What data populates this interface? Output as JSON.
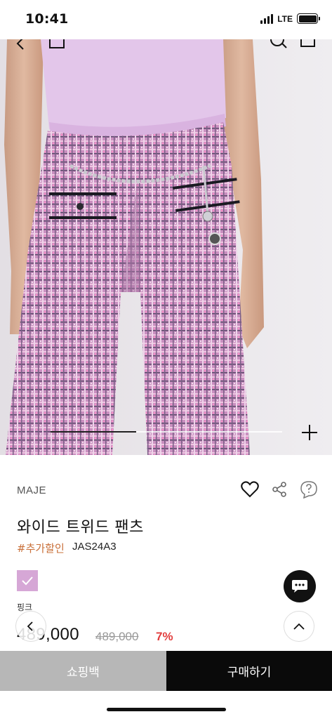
{
  "status_bar": {
    "time": "10:41",
    "network": "LTE"
  },
  "gallery": {
    "current_index_fraction": 0.37
  },
  "product": {
    "brand": "MAJE",
    "title": "와이드 트위드 팬츠",
    "tag": "#추가할인",
    "sku": "JAS24A3",
    "color_label": "핑크",
    "swatch_color": "#d6a7d6",
    "price": "489,000",
    "original_price": "489,000",
    "discount": "7%"
  },
  "bottom_bar": {
    "bag_label": "쇼핑백",
    "buy_label": "구매하기"
  },
  "icons": {
    "nav_back": "chevron-left-icon",
    "nav_home": "home-icon",
    "nav_search": "search-icon",
    "nav_cart": "cart-icon",
    "zoom": "plus-icon",
    "wishlist": "heart-icon",
    "share": "share-icon",
    "qna": "question-icon",
    "chat": "chat-icon",
    "scroll_top": "chevron-up-icon",
    "history_back": "chevron-left-icon"
  },
  "colors": {
    "discount": "#e23d3d",
    "tag": "#c9703a",
    "bag_button": "#b7b7b7",
    "buy_button": "#0a0a0a"
  }
}
